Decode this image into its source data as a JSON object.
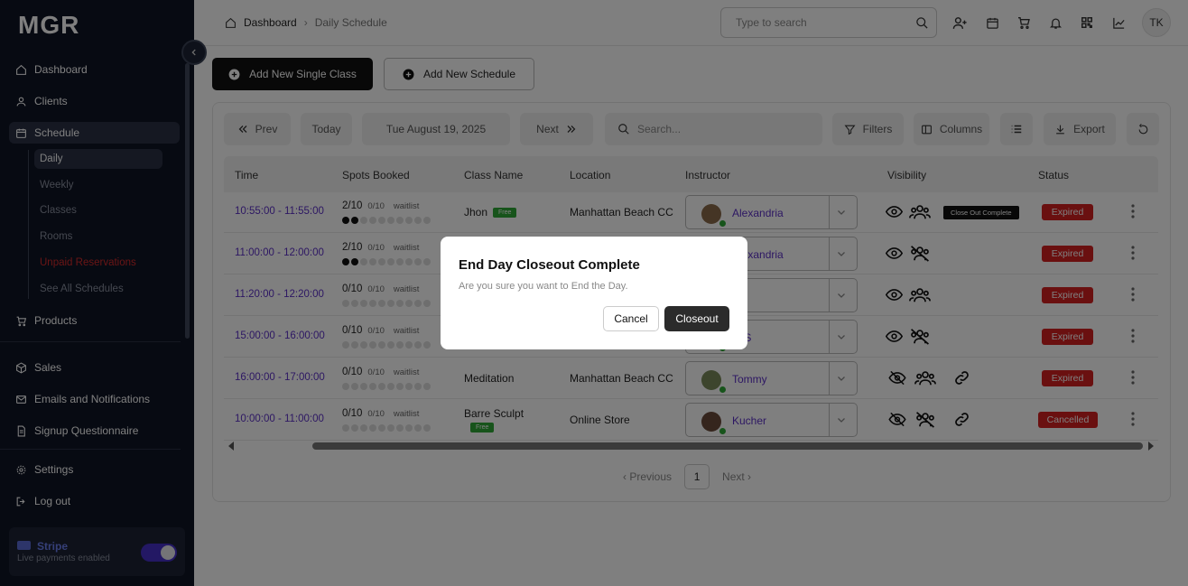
{
  "app": {
    "logo": "MGR"
  },
  "sidebar": {
    "items": [
      {
        "label": "Dashboard",
        "icon": "home-icon"
      },
      {
        "label": "Clients",
        "icon": "user-icon"
      },
      {
        "label": "Schedule",
        "icon": "calendar-icon"
      },
      {
        "label": "Products",
        "icon": "cart-icon"
      },
      {
        "label": "Sales",
        "icon": "box-icon"
      },
      {
        "label": "Emails and Notifications",
        "icon": "mail-icon"
      },
      {
        "label": "Signup Questionnaire",
        "icon": "document-icon"
      },
      {
        "label": "Settings",
        "icon": "gear-icon"
      },
      {
        "label": "Log out",
        "icon": "logout-icon"
      }
    ],
    "schedule_sub": [
      "Daily",
      "Weekly",
      "Classes",
      "Rooms",
      "Unpaid Reservations",
      "See All Schedules"
    ],
    "stripe": {
      "name": "Stripe",
      "status": "Live payments enabled",
      "enabled": true
    }
  },
  "header": {
    "breadcrumb": [
      "Dashboard",
      "Daily Schedule"
    ],
    "search_placeholder": "Type to search",
    "avatar_initials": "TK"
  },
  "actions": {
    "add_single": "Add New Single Class",
    "add_schedule": "Add New Schedule"
  },
  "toolbar": {
    "prev": "Prev",
    "today": "Today",
    "date": "Tue August 19, 2025",
    "next": "Next",
    "search_placeholder": "Search...",
    "filters": "Filters",
    "columns": "Columns",
    "export": "Export"
  },
  "table": {
    "columns": [
      "Time",
      "Spots Booked",
      "Class Name",
      "Location",
      "Instructor",
      "Visibility",
      "Status"
    ],
    "rows": [
      {
        "time": "10:55:00 - 11:55:00",
        "booked": "2/10",
        "max": "0/10",
        "waitlist": "waitlist",
        "class": "Jhon",
        "free": "Free",
        "location": "Manhattan Beach CC",
        "instructor": "Alexandria",
        "status": "Expired",
        "tooltip": "Close Out Complete"
      },
      {
        "time": "11:00:00 - 12:00:00",
        "booked": "2/10",
        "max": "0/10",
        "waitlist": "waitlist",
        "class": "",
        "location": "",
        "instructor": "Alexandria",
        "status": "Expired"
      },
      {
        "time": "11:20:00 - 12:20:00",
        "booked": "0/10",
        "max": "0/10",
        "waitlist": "waitlist",
        "class": "",
        "location": "",
        "instructor": "y",
        "status": "Expired"
      },
      {
        "time": "15:00:00 - 16:00:00",
        "booked": "0/10",
        "max": "0/10",
        "waitlist": "waitlist",
        "class": "",
        "location": "",
        "instructor": "et S",
        "status": "Expired"
      },
      {
        "time": "16:00:00 - 17:00:00",
        "booked": "0/10",
        "max": "0/10",
        "waitlist": "waitlist",
        "class": "Meditation",
        "location": "Manhattan Beach CC",
        "instructor": "Tommy",
        "status": "Expired"
      },
      {
        "time": "10:00:00 - 11:00:00",
        "booked": "0/10",
        "max": "0/10",
        "waitlist": "waitlist",
        "class": "Barre Sculpt",
        "free": "Free",
        "location": "Online Store",
        "instructor": "Kucher",
        "status": "Cancelled"
      }
    ]
  },
  "pagination": {
    "previous": "Previous",
    "page": "1",
    "next": "Next"
  },
  "modal": {
    "title": "End Day Closeout Complete",
    "message": "Are you sure you want to End the Day.",
    "cancel": "Cancel",
    "confirm": "Closeout"
  }
}
